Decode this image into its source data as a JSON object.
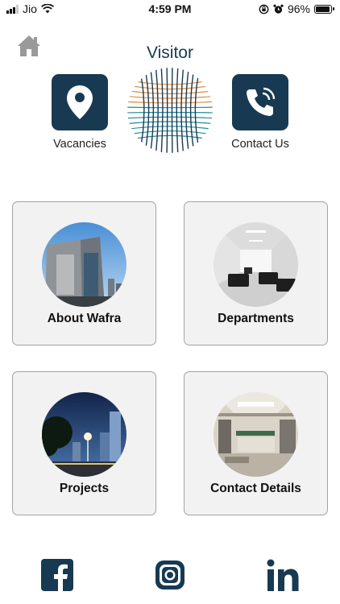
{
  "status_bar": {
    "carrier": "Jio",
    "time": "4:59 PM",
    "battery": "96%",
    "battery_level": 0.96,
    "icons": [
      "signal-icon",
      "wifi-icon",
      "orientation-lock-icon",
      "alarm-icon",
      "battery-icon"
    ]
  },
  "header": {
    "title": "Visitor",
    "home_icon": "home-icon"
  },
  "quick_links": {
    "vacancies_label": "Vacancies",
    "contact_us_label": "Contact Us"
  },
  "cards": [
    {
      "label": "About Wafra"
    },
    {
      "label": "Departments"
    },
    {
      "label": "Projects"
    },
    {
      "label": "Contact Details"
    }
  ],
  "social": [
    "facebook-icon",
    "instagram-icon",
    "linkedin-icon"
  ],
  "colors": {
    "brand_navy": "#173a52",
    "card_background": "#f2f2f2",
    "card_border": "#a3a3a3",
    "logo_orange": "#e08a3c",
    "logo_teal": "#1f8aa0"
  }
}
